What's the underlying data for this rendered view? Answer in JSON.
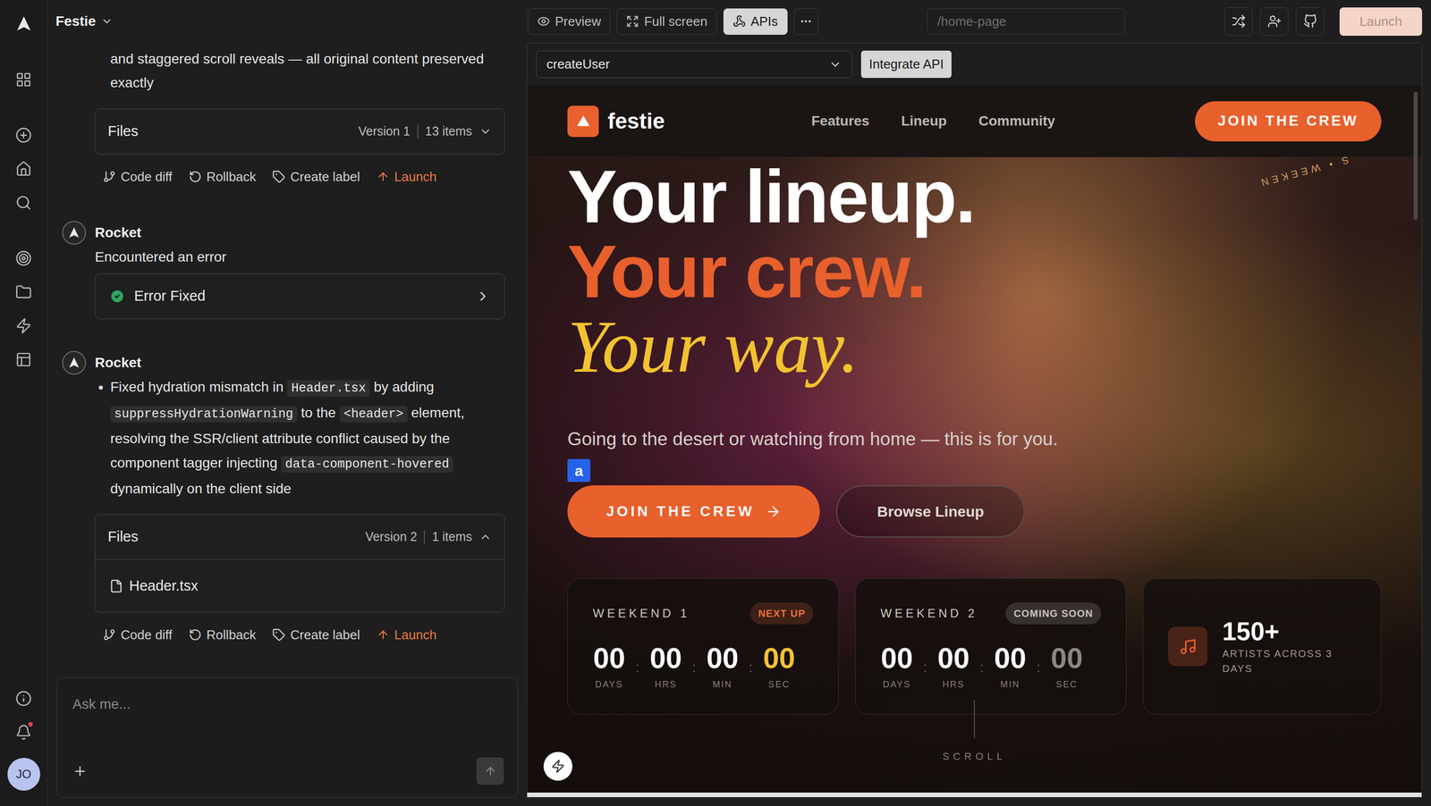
{
  "project": {
    "title": "Festie"
  },
  "rail": {
    "notifications_unread": true,
    "avatar": "JO"
  },
  "chat": {
    "messages": [
      {
        "kind": "continuation",
        "text": "and staggered scroll reveals — all original content preserved exactly",
        "files": {
          "label": "Files",
          "version": "Version 1",
          "count": "13 items",
          "expanded": false,
          "items": []
        },
        "actions": [
          {
            "label": "Code diff",
            "kind": "diff"
          },
          {
            "label": "Rollback",
            "kind": "rollback"
          },
          {
            "label": "Create label",
            "kind": "label"
          },
          {
            "label": "Launch",
            "kind": "launch"
          }
        ]
      },
      {
        "kind": "status",
        "author": "Rocket",
        "text": "Encountered an error",
        "status": {
          "label": "Error Fixed",
          "ok": true
        }
      },
      {
        "kind": "bullets",
        "author": "Rocket",
        "segments": [
          {
            "text": "Fixed hydration mismatch in ",
            "code": false
          },
          {
            "text": "Header.tsx",
            "code": true
          },
          {
            "text": " by adding ",
            "code": false
          },
          {
            "text": "suppressHydrationWarning",
            "code": true
          },
          {
            "text": " to the ",
            "code": false
          },
          {
            "text": "<header>",
            "code": true
          },
          {
            "text": " element, resolving the SSR/client attribute conflict caused by the component tagger injecting ",
            "code": false
          },
          {
            "text": "data-component-hovered",
            "code": true
          },
          {
            "text": " dynamically on the client side",
            "code": false
          }
        ],
        "files": {
          "label": "Files",
          "version": "Version 2",
          "count": "1 items",
          "expanded": true,
          "items": [
            "Header.tsx"
          ]
        },
        "actions": [
          {
            "label": "Code diff",
            "kind": "diff"
          },
          {
            "label": "Rollback",
            "kind": "rollback"
          },
          {
            "label": "Create label",
            "kind": "label"
          },
          {
            "label": "Launch",
            "kind": "launch"
          }
        ]
      }
    ],
    "input": {
      "placeholder": "Ask me..."
    }
  },
  "toolbar": {
    "tabs": [
      {
        "label": "Preview",
        "kind": "preview",
        "selected": false
      },
      {
        "label": "Full screen",
        "kind": "fullscreen",
        "selected": false
      },
      {
        "label": "APIs",
        "kind": "apis",
        "selected": true
      }
    ],
    "url": "/home-page",
    "launch": {
      "label": "Launch",
      "disabled": true
    }
  },
  "api_bar": {
    "endpoint": "createUser",
    "button": "Integrate API"
  },
  "site": {
    "brand": "festie",
    "nav": [
      "Features",
      "Lineup",
      "Community"
    ],
    "cta": "JOIN THE CREW",
    "ring_text": "S • WEEKEN",
    "hero": {
      "lines": [
        "Your lineup.",
        "Your crew.",
        "Your way."
      ],
      "subtitle": "Going to the desert or watching from home — this is for you.",
      "tag": "a",
      "primary": "JOIN THE CREW",
      "secondary": "Browse Lineup"
    },
    "separator": ":",
    "countdowns": [
      {
        "title": "WEEKEND 1",
        "badge": "NEXT UP",
        "color": "#f0703c",
        "units": [
          {
            "value": "00",
            "label": "DAYS",
            "kind": "plain"
          },
          {
            "value": "00",
            "label": "HRS",
            "kind": "plain"
          },
          {
            "value": "00",
            "label": "MIN",
            "kind": "plain"
          },
          {
            "value": "00",
            "label": "SEC",
            "kind": "accent"
          }
        ]
      },
      {
        "title": "WEEKEND 2",
        "badge": "COMING SOON",
        "color": "#c9c4c0",
        "units": [
          {
            "value": "00",
            "label": "DAYS",
            "kind": "plain"
          },
          {
            "value": "00",
            "label": "HRS",
            "kind": "plain"
          },
          {
            "value": "00",
            "label": "MIN",
            "kind": "plain"
          },
          {
            "value": "00",
            "label": "SEC",
            "kind": "muted"
          }
        ]
      }
    ],
    "stat": {
      "value": "150+",
      "label": "ARTISTS ACROSS 3 DAYS"
    },
    "scroll": "SCROLL"
  }
}
